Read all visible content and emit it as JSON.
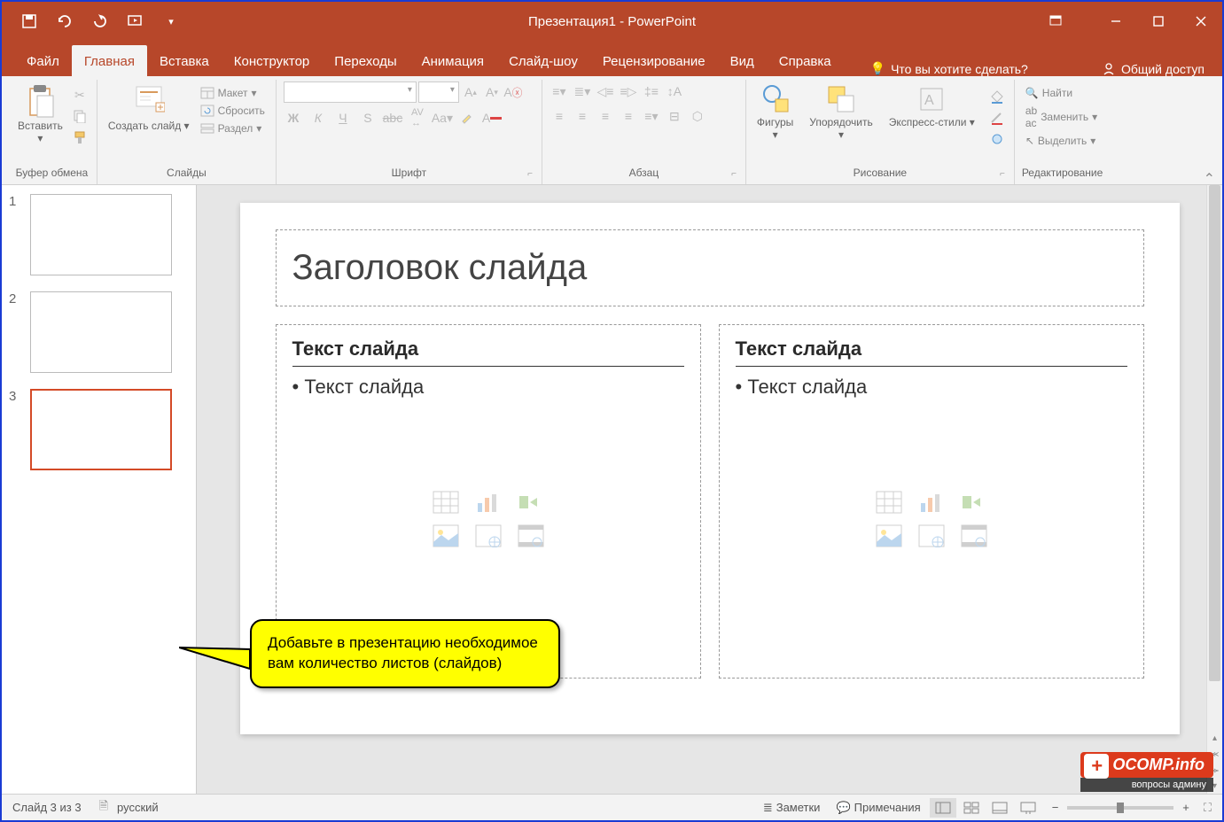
{
  "title": "Презентация1 - PowerPoint",
  "tabs": {
    "file": "Файл",
    "home": "Главная",
    "insert": "Вставка",
    "design": "Конструктор",
    "transitions": "Переходы",
    "animations": "Анимация",
    "slideshow": "Слайд-шоу",
    "review": "Рецензирование",
    "view": "Вид",
    "help": "Справка"
  },
  "tellme": "Что вы хотите сделать?",
  "share": "Общий доступ",
  "ribbon": {
    "clipboard": {
      "label": "Буфер обмена",
      "paste": "Вставить"
    },
    "slides": {
      "label": "Слайды",
      "new_slide": "Создать слайд",
      "layout": "Макет",
      "reset": "Сбросить",
      "section": "Раздел"
    },
    "font": {
      "label": "Шрифт"
    },
    "paragraph": {
      "label": "Абзац"
    },
    "drawing": {
      "label": "Рисование",
      "shapes": "Фигуры",
      "arrange": "Упорядочить",
      "styles": "Экспресс-стили"
    },
    "editing": {
      "label": "Редактирование",
      "find": "Найти",
      "replace": "Заменить",
      "select": "Выделить"
    }
  },
  "thumbnails": [
    {
      "num": "1",
      "selected": false
    },
    {
      "num": "2",
      "selected": false
    },
    {
      "num": "3",
      "selected": true
    }
  ],
  "slide": {
    "title": "Заголовок слайда",
    "left": {
      "heading": "Текст слайда",
      "bullet": "• Текст слайда"
    },
    "right": {
      "heading": "Текст слайда",
      "bullet": "• Текст слайда"
    }
  },
  "callout": "Добавьте в презентацию необходимое вам количество листов (слайдов)",
  "statusbar": {
    "slide_info": "Слайд 3 из 3",
    "language": "русский",
    "notes": "Заметки",
    "comments": "Примечания"
  },
  "watermark": {
    "top": "OCOMP.info",
    "bottom": "вопросы админу"
  }
}
